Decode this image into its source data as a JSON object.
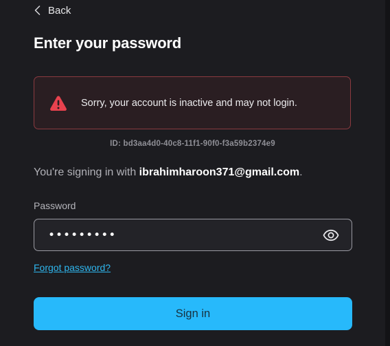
{
  "nav": {
    "back_label": "Back"
  },
  "page": {
    "title": "Enter your password"
  },
  "error": {
    "message": "Sorry, your account is inactive and may not login.",
    "id_text": "ID: bd3aa4d0-40c8-11f1-90f0-f3a59b2374e9",
    "icon": "warning-triangle-icon"
  },
  "account": {
    "prefix": "You're signing in with ",
    "email": "ibrahimharoon371@gmail.com",
    "suffix": "."
  },
  "password": {
    "label": "Password",
    "value": "•••••••••",
    "toggle_icon": "eye-icon"
  },
  "links": {
    "forgot": "Forgot password?"
  },
  "actions": {
    "sign_in": "Sign in"
  },
  "colors": {
    "background": "#1c1c20",
    "error_border": "#8b3a40",
    "error_icon": "#e8424e",
    "link": "#2fb7ef",
    "primary_button": "#27b9fb"
  }
}
